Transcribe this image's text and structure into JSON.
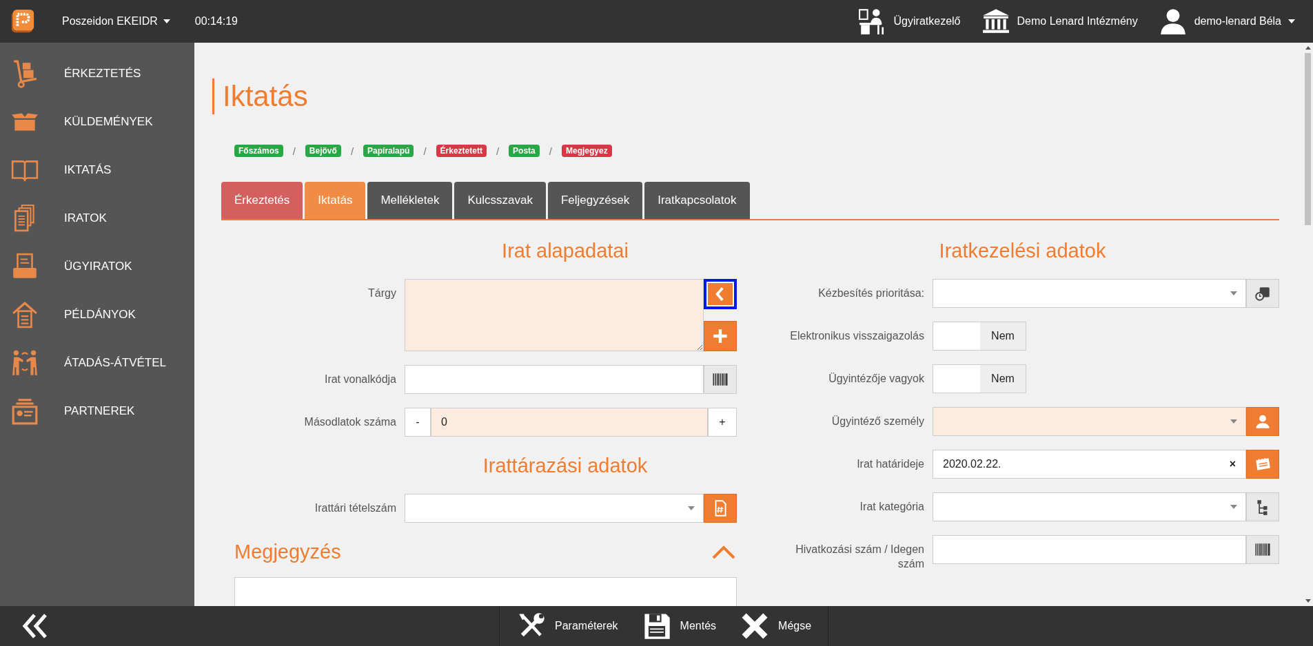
{
  "topbar": {
    "app_name": "Poszeidon EKEIDR",
    "timer": "00:14:19",
    "links": [
      {
        "label": "Ügyiratkezelő",
        "kind": "desk"
      },
      {
        "label": "Demo Lenard Intézmény",
        "kind": "institution"
      }
    ],
    "user": "demo-lenard Béla"
  },
  "sidebar": {
    "items": [
      {
        "label": "ÉRKEZTETÉS",
        "kind": "trolley"
      },
      {
        "label": "KÜLDEMÉNYEK",
        "kind": "box"
      },
      {
        "label": "IKTATÁS",
        "kind": "book"
      },
      {
        "label": "IRATOK",
        "kind": "documents"
      },
      {
        "label": "ÜGYIRATOK",
        "kind": "tray"
      },
      {
        "label": "PÉLDÁNYOK",
        "kind": "copies"
      },
      {
        "label": "ÁTADÁS-ÁTVÉTEL",
        "kind": "handover"
      },
      {
        "label": "PARTNEREK",
        "kind": "cardfile"
      }
    ]
  },
  "page": {
    "title": "Iktatás",
    "breadcrumb_separator": "/",
    "breadcrumb": [
      {
        "label": "Főszámos",
        "color": "#28a745"
      },
      {
        "label": "Bejövő",
        "color": "#28a745"
      },
      {
        "label": "Papíralapú",
        "color": "#28a745"
      },
      {
        "label": "Érkeztetett",
        "color": "#dc3545"
      },
      {
        "label": "Posta",
        "color": "#28a745"
      },
      {
        "label": "Megjegyez",
        "color": "#dc3545"
      }
    ],
    "tabs": [
      {
        "label": "Érkeztetés",
        "selected": false,
        "done": true
      },
      {
        "label": "Iktatás",
        "selected": true,
        "done": false
      },
      {
        "label": "Mellékletek",
        "selected": false,
        "done": false
      },
      {
        "label": "Kulcsszavak",
        "selected": false,
        "done": false
      },
      {
        "label": "Feljegyzések",
        "selected": false,
        "done": false
      },
      {
        "label": "Iratkapcsolatok",
        "selected": false,
        "done": false
      }
    ]
  },
  "basic_data": {
    "title": "Irat alapadatai",
    "fields": [
      {
        "label": "Tárgy",
        "kind": "textarea",
        "required": true,
        "buttons": [
          {
            "kind": "back",
            "accent": true,
            "focused": true
          },
          {
            "kind": "add",
            "accent": true,
            "focused": false
          }
        ]
      },
      {
        "label": "Irat vonalkódja",
        "kind": "input",
        "required": false,
        "buttons": [
          {
            "kind": "barcode",
            "accent": false,
            "focused": false
          }
        ]
      },
      {
        "label": "Másodlatok száma",
        "kind": "stepper",
        "required": true,
        "value": "0",
        "decrement": "-",
        "increment": "+"
      }
    ]
  },
  "archiving": {
    "title": "Irattárazási adatok",
    "fields": [
      {
        "label": "Irattári tételszám",
        "kind": "select",
        "required": false,
        "buttons": [
          {
            "kind": "file-hash",
            "accent": true,
            "focused": false
          }
        ]
      }
    ]
  },
  "note": {
    "title": "Megjegyzés",
    "expanded": true
  },
  "handling_data": {
    "title": "Iratkezelési adatok",
    "fields": [
      {
        "label": "Kézbesítés prioritása:",
        "kind": "select",
        "required": false,
        "buttons": [
          {
            "kind": "priority",
            "accent": false,
            "focused": false
          }
        ]
      },
      {
        "label": "Elektronikus visszaigazolás",
        "kind": "toggle",
        "on": false,
        "value": "Nem"
      },
      {
        "label": "Ügyintézője vagyok",
        "kind": "toggle",
        "on": false,
        "value": "Nem"
      },
      {
        "label": "Ügyintéző személy",
        "kind": "select",
        "required": true,
        "buttons": [
          {
            "kind": "person",
            "accent": true,
            "focused": false
          }
        ]
      },
      {
        "label": "Irat határideje",
        "kind": "date",
        "required": false,
        "value": "2020.02.22.",
        "clear": "×",
        "buttons": [
          {
            "kind": "calendar",
            "accent": true,
            "focused": false
          }
        ]
      },
      {
        "label": "Irat kategória",
        "kind": "select",
        "required": false,
        "buttons": [
          {
            "kind": "tree",
            "accent": false,
            "focused": false
          }
        ]
      },
      {
        "label": "Hivatkozási szám / Idegen szám",
        "kind": "input",
        "required": false,
        "buttons": [
          {
            "kind": "barcode",
            "accent": false,
            "focused": false
          }
        ]
      }
    ]
  },
  "bottom_bar": {
    "actions": [
      {
        "label": "Paraméterek",
        "kind": "tools"
      },
      {
        "label": "Mentés",
        "kind": "save"
      },
      {
        "label": "Mégse",
        "kind": "cancel"
      }
    ]
  }
}
